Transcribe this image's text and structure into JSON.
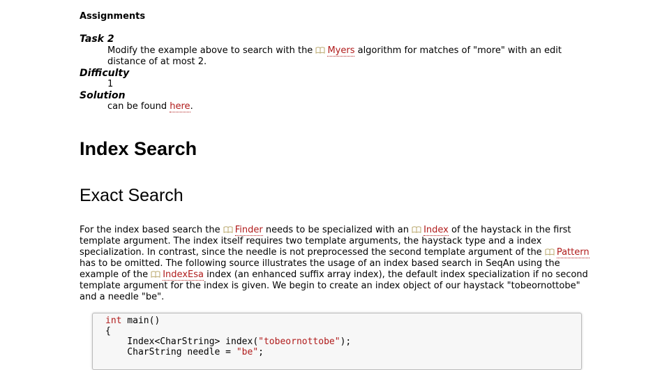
{
  "assignments": {
    "heading": "Assignments",
    "task": {
      "term": "Task 2",
      "text_before": "Modify the example above to search with the ",
      "link": "Myers",
      "text_after": " algorithm for matches of \"more\" with an edit distance of at most 2."
    },
    "difficulty": {
      "term": "Difficulty",
      "value": "1"
    },
    "solution": {
      "term": "Solution",
      "text_before": "can be found ",
      "link": "here",
      "text_after": "."
    }
  },
  "section": {
    "h1": "Index Search",
    "h2": "Exact Search"
  },
  "paragraph": {
    "p1": "For the index based search the ",
    "finder": "Finder",
    "p2": " needs to be specialized with an ",
    "index": "Index",
    "p3": " of the haystack in the first template argument. The index itself requires two template arguments, the haystack type and a index specialization. In contrast, since the needle is not preprocessed the second template argument of the ",
    "pattern": "Pattern",
    "p4": " has to be omitted. The following source illustrates the usage of an index based search in SeqAn using the example of the ",
    "indexesa": "IndexEsa",
    "p5": " index (an enhanced suffix array index), the default index specialization if no second template argument for the index is given. We begin to create an index object of our haystack \"tobeornottobe\" and a needle \"be\"."
  },
  "code": {
    "l1_kw": "int",
    "l1_rest": " main()",
    "l2": "{",
    "l3_a": "    Index<CharString> index(",
    "l3_str": "\"tobeornottobe\"",
    "l3_b": ");",
    "l4_a": "    CharString needle = ",
    "l4_str": "\"be\"",
    "l4_b": ";"
  },
  "icons": {
    "reference": "book-icon"
  },
  "colors": {
    "link": "#b01b1b",
    "code_bg": "#f7f7f7"
  }
}
